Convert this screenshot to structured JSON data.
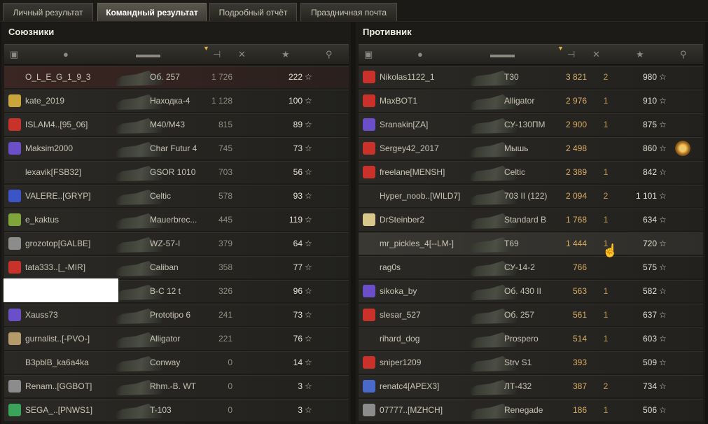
{
  "tabs": [
    {
      "label": "Личный результат",
      "active": false
    },
    {
      "label": "Командный результат",
      "active": true
    },
    {
      "label": "Подробный отчёт",
      "active": false
    },
    {
      "label": "Праздничная почта",
      "active": false
    }
  ],
  "allies": {
    "title": "Союзники",
    "players": [
      {
        "name": "O_L_E_G_1_9_3",
        "vehicle": "Об. 257",
        "damage": "1 726",
        "frags": "",
        "xp": "222",
        "icon": "",
        "self": true
      },
      {
        "name": "kate_2019",
        "vehicle": "Находка-4",
        "damage": "1 128",
        "frags": "",
        "xp": "100",
        "icon": "#c9a53b"
      },
      {
        "name": "ISLAM4..[95_06]",
        "vehicle": "M40/M43",
        "damage": "815",
        "frags": "",
        "xp": "89",
        "icon": "#c9322a"
      },
      {
        "name": "Maksim2000",
        "vehicle": "Char Futur 4",
        "damage": "745",
        "frags": "",
        "xp": "73",
        "icon": "#6a4fc9"
      },
      {
        "name": "lexavik[FSB32]",
        "vehicle": "GSOR 1010",
        "damage": "703",
        "frags": "",
        "xp": "56",
        "icon": ""
      },
      {
        "name": "VALERE..[GRYP]",
        "vehicle": "Celtic",
        "damage": "578",
        "frags": "",
        "xp": "93",
        "icon": "#3b55c9"
      },
      {
        "name": "e_kaktus",
        "vehicle": "Mauerbrec...",
        "damage": "445",
        "frags": "",
        "xp": "119",
        "icon": "#7fa43a"
      },
      {
        "name": "grozotop[GALBE]",
        "vehicle": "WZ-57-I",
        "damage": "379",
        "frags": "",
        "xp": "64",
        "icon": "#8c8c8c"
      },
      {
        "name": "tata333..[_-MIR]",
        "vehicle": "Caliban",
        "damage": "358",
        "frags": "",
        "xp": "77",
        "icon": "#c9322a"
      },
      {
        "name": "",
        "vehicle": "B-C 12 t",
        "damage": "326",
        "frags": "",
        "xp": "96",
        "icon": ""
      },
      {
        "name": "Xauss73",
        "vehicle": "Prototipo 6",
        "damage": "241",
        "frags": "",
        "xp": "73",
        "icon": "#6a4fc9"
      },
      {
        "name": "gurnalist..[-PVO-]",
        "vehicle": "Alligator",
        "damage": "221",
        "frags": "",
        "xp": "76",
        "icon": "#b59a6a"
      },
      {
        "name": "B3pblB_ka6a4ka",
        "vehicle": "Conway",
        "damage": "0",
        "frags": "",
        "xp": "14",
        "icon": ""
      },
      {
        "name": "Renam..[GGBOT]",
        "vehicle": "Rhm.-B. WT",
        "damage": "0",
        "frags": "",
        "xp": "3",
        "icon": "#8c8c8c"
      },
      {
        "name": "SEGA_..[PNWS1]",
        "vehicle": "T-103",
        "damage": "0",
        "frags": "",
        "xp": "3",
        "icon": "#3aa35a"
      }
    ]
  },
  "enemies": {
    "title": "Противник",
    "players": [
      {
        "name": "Nikolas1122_1",
        "vehicle": "T30",
        "damage": "3 821",
        "frags": "2",
        "xp": "980",
        "icon": "#c9322a"
      },
      {
        "name": "MaxBOT1",
        "vehicle": "Alligator",
        "damage": "2 976",
        "frags": "1",
        "xp": "910",
        "icon": "#c9322a"
      },
      {
        "name": "Sranakin[ZA]",
        "vehicle": "СУ-130ПМ",
        "damage": "2 900",
        "frags": "1",
        "xp": "875",
        "icon": "#6a4fc9"
      },
      {
        "name": "Sergey42_2017",
        "vehicle": "Мышь",
        "damage": "2 498",
        "frags": "",
        "xp": "860",
        "icon": "#c9322a",
        "medal": true
      },
      {
        "name": "freelane[MENSH]",
        "vehicle": "Celtic",
        "damage": "2 389",
        "frags": "1",
        "xp": "842",
        "icon": "#c9322a"
      },
      {
        "name": "Hyper_noob..[WILD7]",
        "vehicle": "703 II (122)",
        "damage": "2 094",
        "frags": "2",
        "xp": "1 101",
        "icon": ""
      },
      {
        "name": "DrSteinber2",
        "vehicle": "Standard B",
        "damage": "1 768",
        "frags": "1",
        "xp": "634",
        "icon": "#d8c98a"
      },
      {
        "name": "mr_pickles_4[--LM-]",
        "vehicle": "T69",
        "damage": "1 444",
        "frags": "1",
        "xp": "720",
        "icon": "",
        "hover": true
      },
      {
        "name": "rag0s",
        "vehicle": "СУ-14-2",
        "damage": "766",
        "frags": "",
        "xp": "575",
        "icon": ""
      },
      {
        "name": "sikoka_by",
        "vehicle": "Об. 430 II",
        "damage": "563",
        "frags": "1",
        "xp": "582",
        "icon": "#6a4fc9"
      },
      {
        "name": "slesar_527",
        "vehicle": "Об. 257",
        "damage": "561",
        "frags": "1",
        "xp": "637",
        "icon": "#c9322a"
      },
      {
        "name": "rihard_dog",
        "vehicle": "Prospero",
        "damage": "514",
        "frags": "1",
        "xp": "603",
        "icon": ""
      },
      {
        "name": "sniper1209",
        "vehicle": "Strv S1",
        "damage": "393",
        "frags": "",
        "xp": "509",
        "icon": "#c9322a"
      },
      {
        "name": "renatc4[APEX3]",
        "vehicle": "ЛТ-432",
        "damage": "387",
        "frags": "2",
        "xp": "734",
        "icon": "#4a6ac9"
      },
      {
        "name": "07777..[MZHCH]",
        "vehicle": "Renegade",
        "damage": "186",
        "frags": "1",
        "xp": "506",
        "icon": "#8c8c8c"
      }
    ]
  },
  "header_icons": [
    "platoon-icon",
    "player-icon",
    "vehicle-icon",
    "damage-icon",
    "frags-icon",
    "xp-icon",
    "medal-icon"
  ],
  "star_glyph": "☆"
}
